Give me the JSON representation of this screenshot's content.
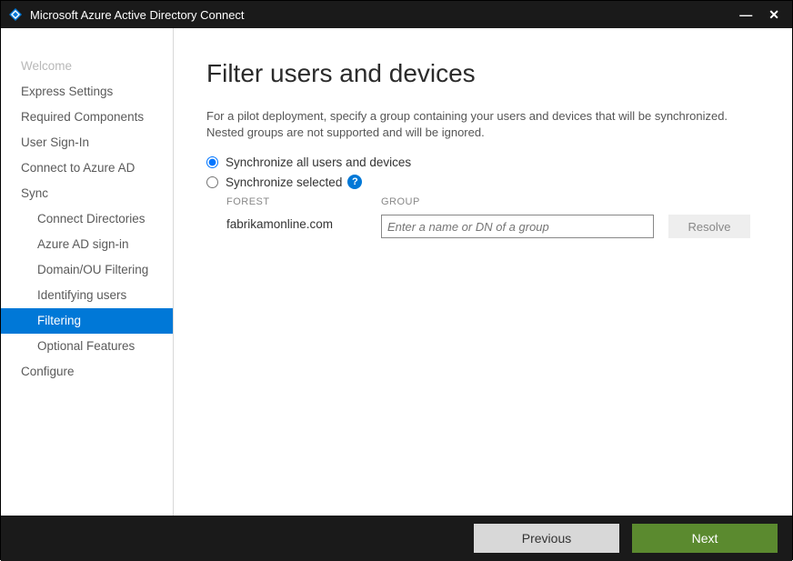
{
  "window": {
    "title": "Microsoft Azure Active Directory Connect"
  },
  "sidebar": {
    "items": [
      {
        "label": "Welcome",
        "state": "disabled"
      },
      {
        "label": "Express Settings",
        "state": "normal"
      },
      {
        "label": "Required Components",
        "state": "normal"
      },
      {
        "label": "User Sign-In",
        "state": "normal"
      },
      {
        "label": "Connect to Azure AD",
        "state": "normal"
      },
      {
        "label": "Sync",
        "state": "normal"
      },
      {
        "label": "Connect Directories",
        "state": "normal",
        "sub": true
      },
      {
        "label": "Azure AD sign-in",
        "state": "normal",
        "sub": true
      },
      {
        "label": "Domain/OU Filtering",
        "state": "normal",
        "sub": true
      },
      {
        "label": "Identifying users",
        "state": "normal",
        "sub": true
      },
      {
        "label": "Filtering",
        "state": "active",
        "sub": true
      },
      {
        "label": "Optional Features",
        "state": "normal",
        "sub": true
      },
      {
        "label": "Configure",
        "state": "normal"
      }
    ]
  },
  "main": {
    "heading": "Filter users and devices",
    "description": "For a pilot deployment, specify a group containing your users and devices that will be synchronized. Nested groups are not supported and will be ignored.",
    "radio_all": "Synchronize all users and devices",
    "radio_selected": "Synchronize selected",
    "help_glyph": "?",
    "col_forest_label": "FOREST",
    "col_group_label": "GROUP",
    "forest_value": "fabrikamonline.com",
    "group_placeholder": "Enter a name or DN of a group",
    "resolve_label": "Resolve"
  },
  "footer": {
    "previous": "Previous",
    "next": "Next"
  }
}
